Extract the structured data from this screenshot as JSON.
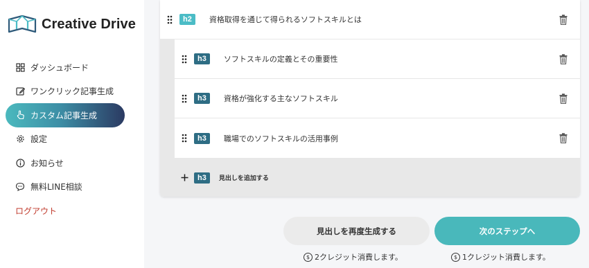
{
  "brand": {
    "name": "Creative Drive"
  },
  "sidebar": {
    "items": [
      {
        "label": "ダッシュボード",
        "icon": "grid-icon"
      },
      {
        "label": "ワンクリック記事生成",
        "icon": "edit-icon"
      },
      {
        "label": "カスタム記事生成",
        "icon": "pointer-hand-icon",
        "active": true
      },
      {
        "label": "設定",
        "icon": "gear-icon"
      },
      {
        "label": "お知らせ",
        "icon": "info-icon"
      },
      {
        "label": "無料LINE相談",
        "icon": "chat-icon"
      }
    ],
    "logout": {
      "label": "ログアウト"
    }
  },
  "outline": {
    "h2": {
      "tag": "h2",
      "text": "資格取得を通じて得られるソフトスキルとは"
    },
    "h3_items": [
      {
        "tag": "h3",
        "text": "ソフトスキルの定義とその重要性"
      },
      {
        "tag": "h3",
        "text": "資格が強化する主なソフトスキル"
      },
      {
        "tag": "h3",
        "text": "職場でのソフトスキルの活用事例"
      }
    ],
    "add": {
      "tag": "h3",
      "label": "見出しを追加する"
    }
  },
  "actions": {
    "regenerate": {
      "label": "見出しを再度生成する",
      "credit": "2クレジット消費します。"
    },
    "next": {
      "label": "次のステップへ",
      "credit": "1クレジット消費します。"
    },
    "coin_symbol": "$"
  },
  "colors": {
    "accent": "#49b8bb",
    "h2_tag": "#4bbcc6",
    "h3_tag": "#2e6d84",
    "logout": "#c0392b",
    "active_gradient_end": "#2b3a62"
  }
}
